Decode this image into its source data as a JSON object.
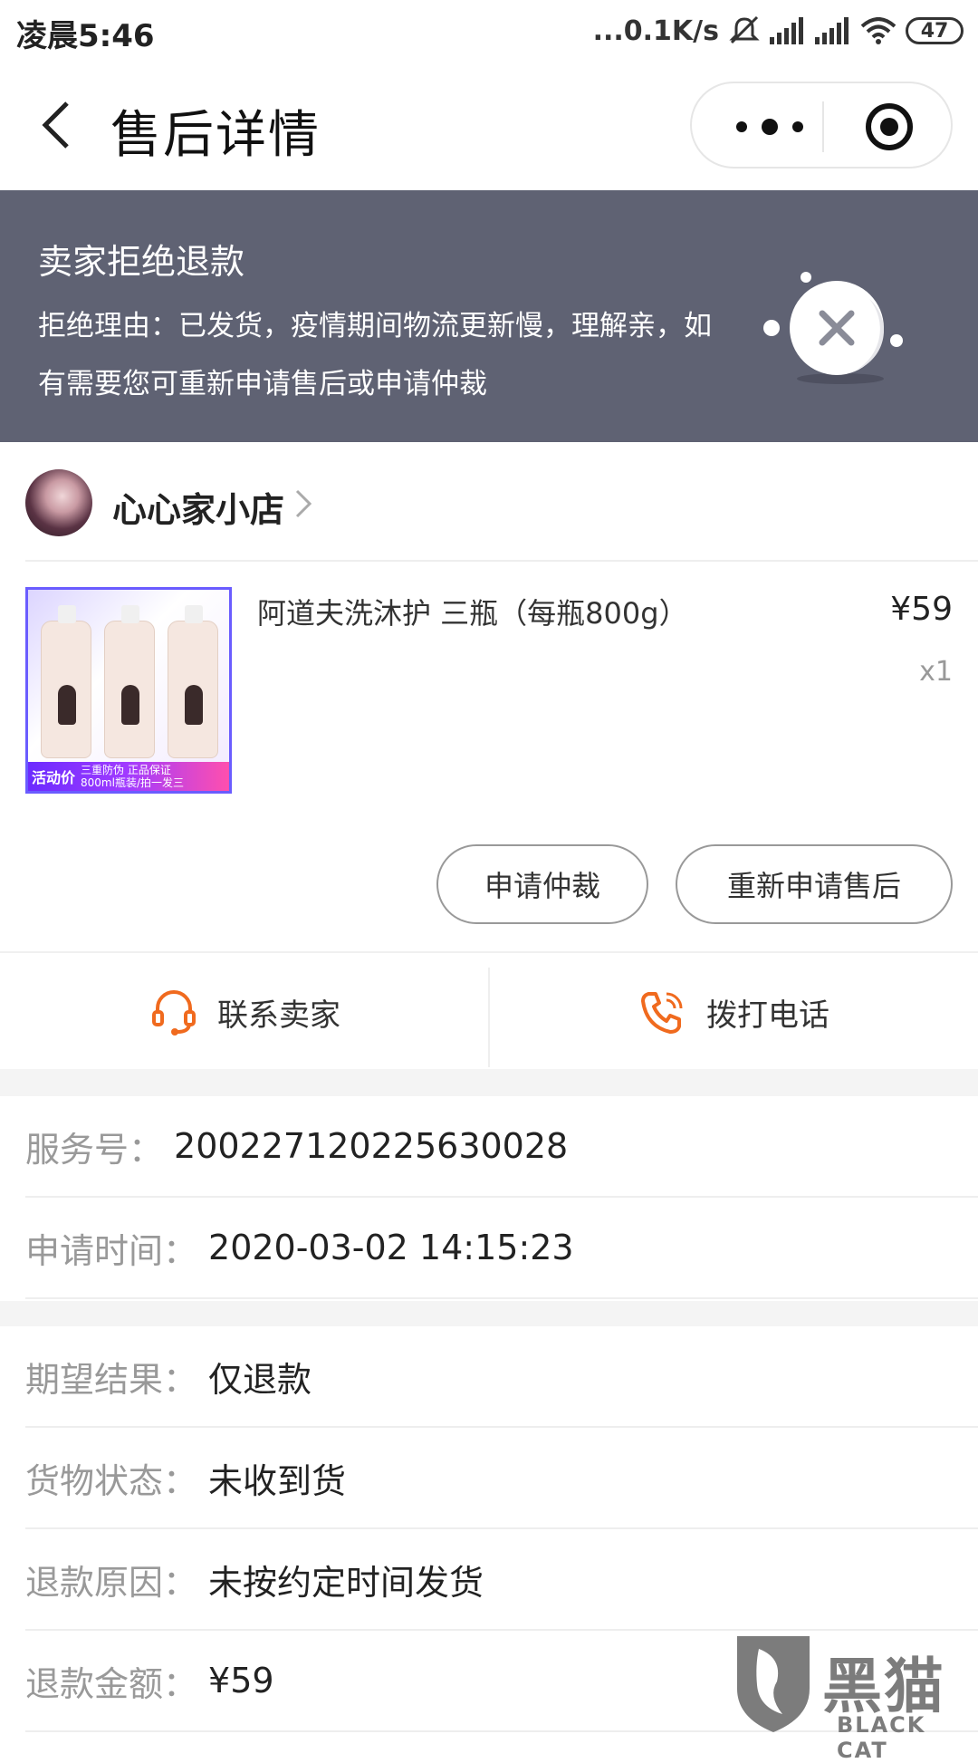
{
  "status_bar": {
    "time": "凌晨5:46",
    "network_speed": "...0.1K/s",
    "battery": "47",
    "icons": [
      "mute-icon",
      "signal-icon",
      "signal-icon",
      "wifi-icon",
      "battery-icon"
    ]
  },
  "nav": {
    "title": "售后详情",
    "back_icon": "chevron-left-icon",
    "more_icon": "more-dots-icon",
    "close_icon": "target-icon"
  },
  "banner": {
    "status": "卖家拒绝退款",
    "reason": "拒绝理由：已发货，疫情期间物流更新慢，理解亲，如有需要您可重新申请售后或申请仲裁",
    "background_color": "#5f6273"
  },
  "shop": {
    "name": "心心家小店"
  },
  "product": {
    "title": "阿道夫洗沐护 三瓶（每瓶800g）",
    "price": "¥59",
    "quantity": "x1",
    "promo_tag": "活动价",
    "promo_line1": "三重防伪 正品保证",
    "promo_line2": "800ml瓶装/拍一发三"
  },
  "actions": {
    "arbitration": "申请仲裁",
    "reapply": "重新申请售后"
  },
  "contact": {
    "seller": "联系卖家",
    "call": "拨打电话",
    "accent_color": "#f06a1e"
  },
  "info": {
    "service_no_label": "服务号：",
    "service_no": "200227120225630028",
    "apply_time_label": "申请时间：",
    "apply_time": "2020-03-02 14:15:23",
    "expected_label": "期望结果：",
    "expected": "仅退款",
    "goods_status_label": "货物状态：",
    "goods_status": "未收到货",
    "refund_reason_label": "退款原因：",
    "refund_reason": "未按约定时间发货",
    "refund_amount_label": "退款金额：",
    "refund_amount": "¥59"
  },
  "watermark": {
    "cn": "黑猫",
    "en": "BLACK CAT"
  }
}
